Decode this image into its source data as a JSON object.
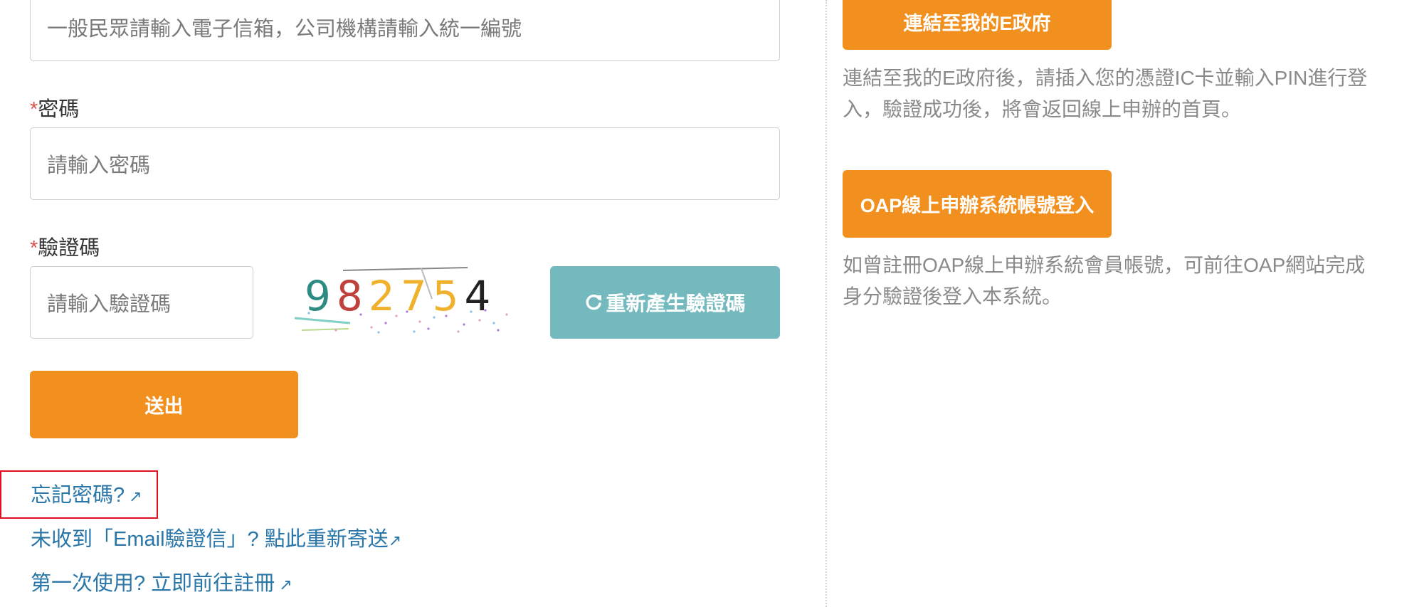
{
  "form": {
    "account_placeholder": "一般民眾請輸入電子信箱，公司機構請輸入統一編號",
    "password": {
      "required_mark": "*",
      "label": "密碼",
      "placeholder": "請輸入密碼"
    },
    "captcha": {
      "required_mark": "*",
      "label": "驗證碼",
      "placeholder": "請輸入驗證碼",
      "image_text": [
        "9",
        "8",
        "2",
        "7",
        "5",
        "4"
      ],
      "image_colors": [
        "#2e8b84",
        "#c0403c",
        "#f0b22c",
        "#f0b22c",
        "#f0b22c",
        "#222222"
      ],
      "refresh_icon": "refresh-icon",
      "refresh_label": "重新產生驗證碼"
    },
    "submit_label": "送出"
  },
  "links": {
    "forgot_password": "忘記密碼?",
    "resend_email": "未收到「Email驗證信」? 點此重新寄送",
    "register": "第一次使用? 立即前往註冊",
    "external_icon": "↗"
  },
  "sidebar": {
    "egov_button": "連結至我的E政府",
    "egov_desc": "連結至我的E政府後，請插入您的憑證IC卡並輸入PIN進行登入，驗證成功後，將會返回線上申辦的首頁。",
    "oap_button": "OAP線上申辦系統帳號登入",
    "oap_desc": "如曾註冊OAP線上申辦系統會員帳號，可前往OAP網站完成身分驗證後登入本系統。"
  },
  "colors": {
    "accent_orange": "#f2901f",
    "accent_teal": "#73b9be",
    "link_blue": "#2a76a8",
    "highlight_red": "#e0101f"
  }
}
